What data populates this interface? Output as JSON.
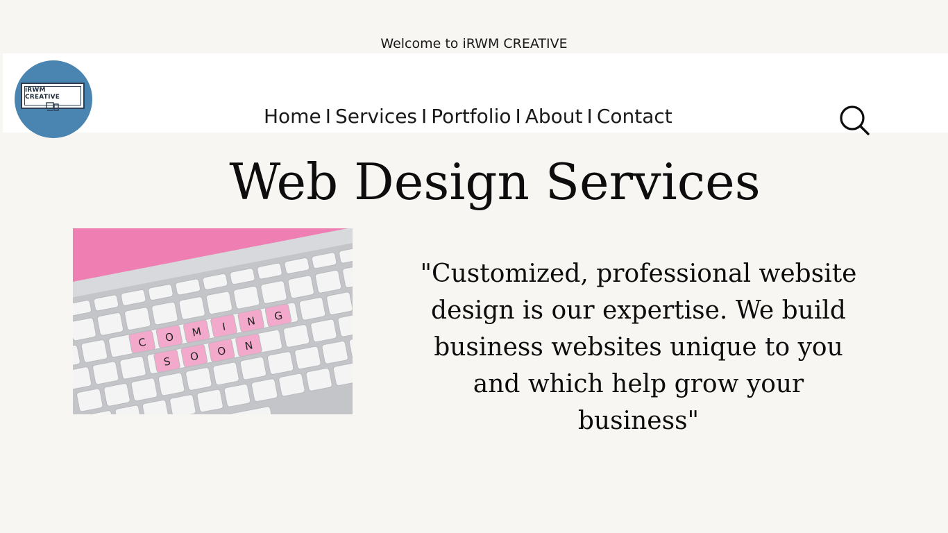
{
  "header": {
    "welcome": "Welcome to iRWM CREATIVE",
    "logo_text": "iRWM CREATIVE",
    "logo_bg": "#4a84b1"
  },
  "nav": {
    "items": [
      "Home",
      "Services",
      "Portfolio",
      "About",
      "Contact"
    ],
    "separator": "I"
  },
  "search_icon": "search-icon",
  "main": {
    "title": "Web Design Services",
    "quote": "\"Customized, professional website design is our expertise. We build business websites unique to you and which help grow your business\"",
    "image": {
      "subject": "keyboard-coming-soon",
      "keys_row1": [
        "C",
        "O",
        "M",
        "I",
        "N",
        "G"
      ],
      "keys_row2": [
        "S",
        "O",
        "O",
        "N"
      ],
      "accent": "#f3a9cc",
      "background": "#ef7fb3"
    }
  }
}
